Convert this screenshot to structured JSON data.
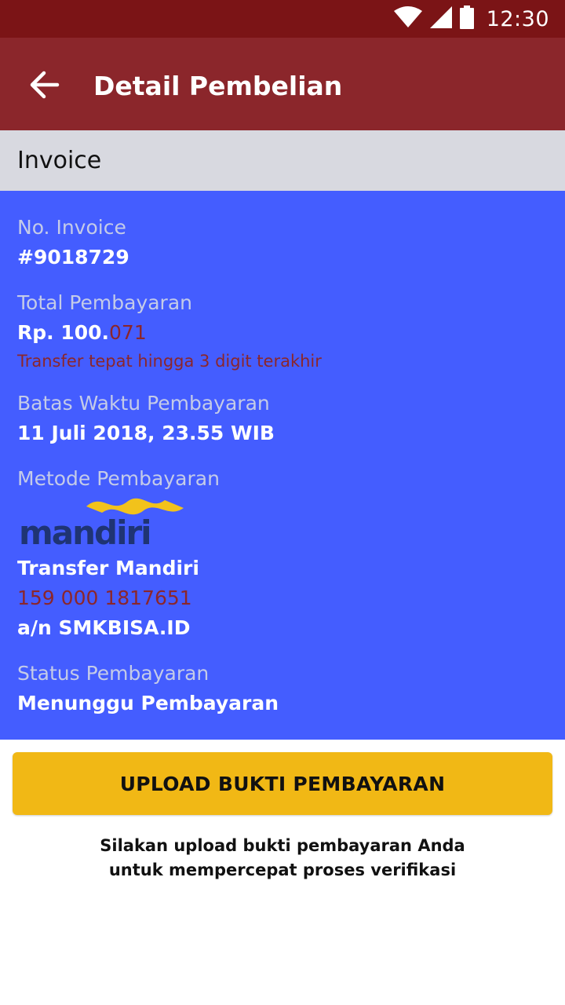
{
  "status_bar": {
    "time": "12:30",
    "icons": [
      "wifi-icon",
      "signal-icon",
      "battery-icon"
    ]
  },
  "app_bar": {
    "title": "Detail Pembelian",
    "back_icon": "arrow-left-icon"
  },
  "section": {
    "title": "Invoice"
  },
  "invoice": {
    "number_label": "No. Invoice",
    "number_value": "#9018729",
    "total_label": "Total Pembayaran",
    "total_main": "Rp. 100.",
    "total_digits": "071",
    "total_note": "Transfer tepat hingga 3 digit terakhir",
    "deadline_label": "Batas Waktu Pembayaran",
    "deadline_value": "11 Juli 2018, 23.55 WIB",
    "method_label": "Metode Pembayaran",
    "bank_logo_text": "mandiri",
    "method_name": "Transfer Mandiri",
    "account_number": "159 000 1817651",
    "account_holder": "a/n SMKBISA.ID",
    "status_label": "Status Pembayaran",
    "status_value": "Menunggu Pembayaran"
  },
  "actions": {
    "upload_label": "UPLOAD BUKTI PEMBAYARAN",
    "helper_line1": "Silakan upload bukti pembayaran Anda",
    "helper_line2": "untuk mempercepat proses verifikasi"
  },
  "colors": {
    "status_bar": "#7b1416",
    "app_bar": "#8b262b",
    "section_header": "#d8d9e0",
    "card": "#445dff",
    "accent_red": "#8b262b",
    "button": "#f1b815"
  }
}
